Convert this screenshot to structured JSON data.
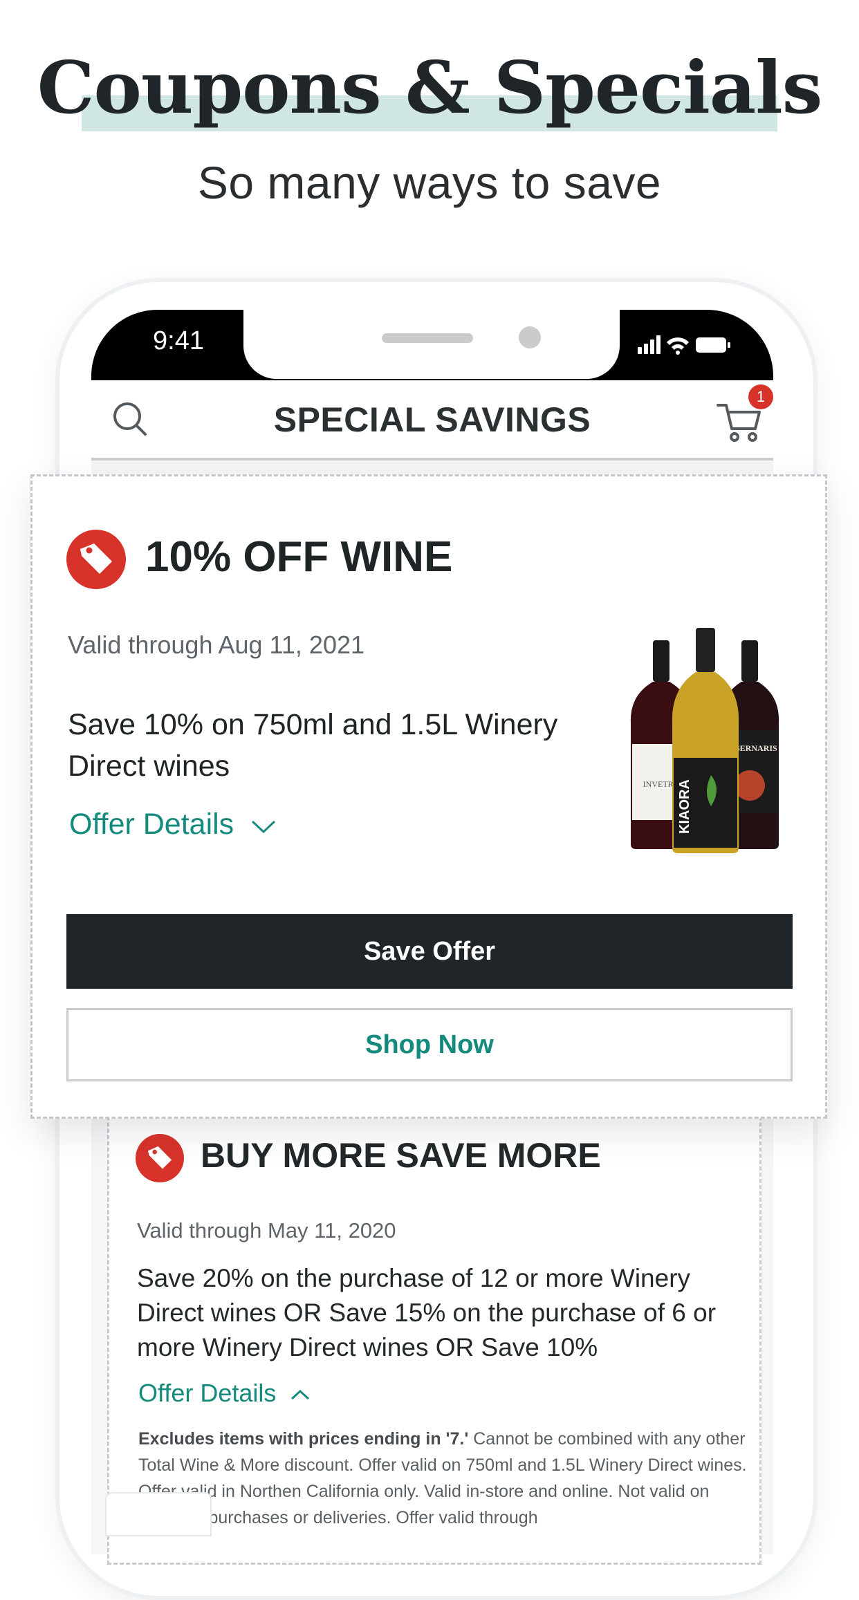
{
  "hero": {
    "title": "Coupons & Specials",
    "subtitle": "So many ways to save"
  },
  "status_bar": {
    "time": "9:41"
  },
  "nav": {
    "title": "SPECIAL SAVINGS",
    "cart_count": "1"
  },
  "coupon_main": {
    "title": "10% OFF WINE",
    "valid": "Valid through Aug 11, 2021",
    "description": "Save 10% on 750ml and 1.5L Winery Direct wines",
    "offer_details": "Offer Details",
    "save_button": "Save Offer",
    "shop_button": "Shop Now",
    "bottle_labels": [
      "INVETRO",
      "KIAORA",
      "CABERNARIS"
    ]
  },
  "coupon_second": {
    "title": "BUY MORE SAVE MORE",
    "valid": "Valid through May 11, 2020",
    "description": "Save 20% on the purchase of 12 or more Winery Direct wines OR Save 15% on the purchase of 6 or more Winery Direct wines OR Save 10%",
    "offer_details": "Offer Details",
    "fine_print_bold": "Excludes items with prices ending in '7.'",
    "fine_print": " Cannot be combined with any other Total Wine & More discount. Offer valid on 750ml and 1.5L Winery Direct wines. Offer valid in Northen California only. Valid in-store and online. Not valid on previous purchases or deliveries. Offer valid through"
  },
  "colors": {
    "accent_teal": "#148a7d",
    "tag_red": "#d7332b",
    "dark": "#1f2529",
    "highlight": "#cfe6e2"
  }
}
